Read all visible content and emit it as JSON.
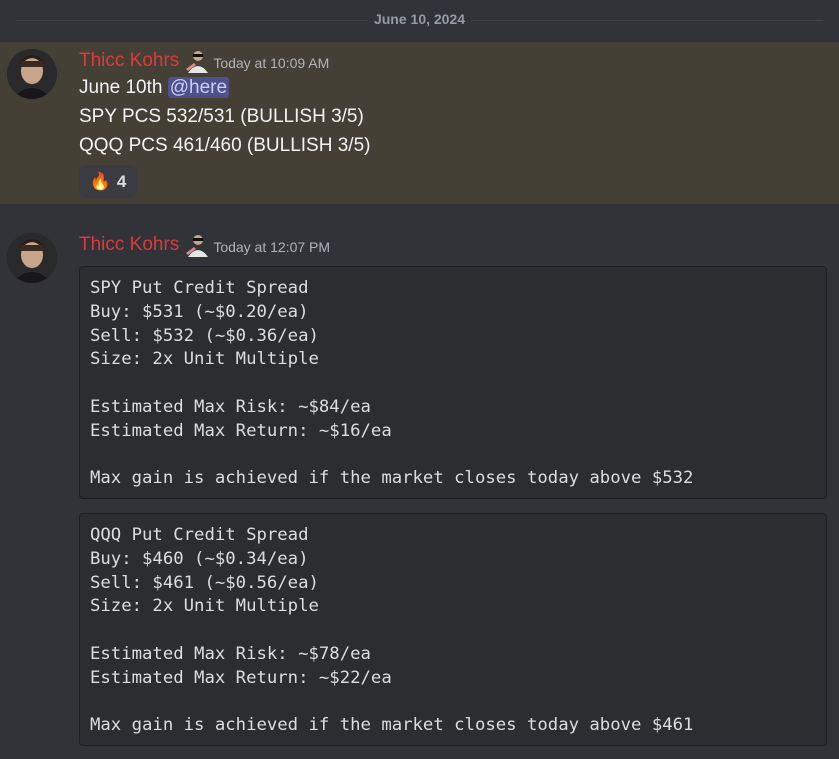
{
  "divider": {
    "date": "June 10, 2024"
  },
  "messages": [
    {
      "username": "Thicc Kohrs",
      "timestamp": "Today at 10:09 AM",
      "lines": [
        "June 10th",
        "SPY PCS 532/531 (BULLISH 3/5)",
        "QQQ PCS 461/460 (BULLISH 3/5)"
      ],
      "mention": "@here",
      "reaction": {
        "emoji": "🔥",
        "emoji_name": "fire-icon",
        "count": "4"
      }
    },
    {
      "username": "Thicc Kohrs",
      "timestamp": "Today at 12:07 PM",
      "code_blocks": [
        {
          "lines": [
            "SPY Put Credit Spread",
            "Buy: $531 (~$0.20/ea)",
            "Sell: $532 (~$0.36/ea)",
            "Size: 2x Unit Multiple",
            "",
            "Estimated Max Risk: ~$84/ea",
            "Estimated Max Return: ~$16/ea",
            "",
            "Max gain is achieved if the market closes today above $532"
          ]
        },
        {
          "lines": [
            "QQQ Put Credit Spread",
            "Buy: $460 (~$0.34/ea)",
            "Sell: $461 (~$0.56/ea)",
            "Size: 2x Unit Multiple",
            "",
            "Estimated Max Risk: ~$78/ea",
            "Estimated Max Return: ~$22/ea",
            "",
            "Max gain is achieved if the market closes today above $461"
          ]
        }
      ]
    }
  ],
  "colors": {
    "username": "#dd3a3a",
    "highlight": "#444036",
    "background": "#313338",
    "mention": "#4f528a"
  }
}
